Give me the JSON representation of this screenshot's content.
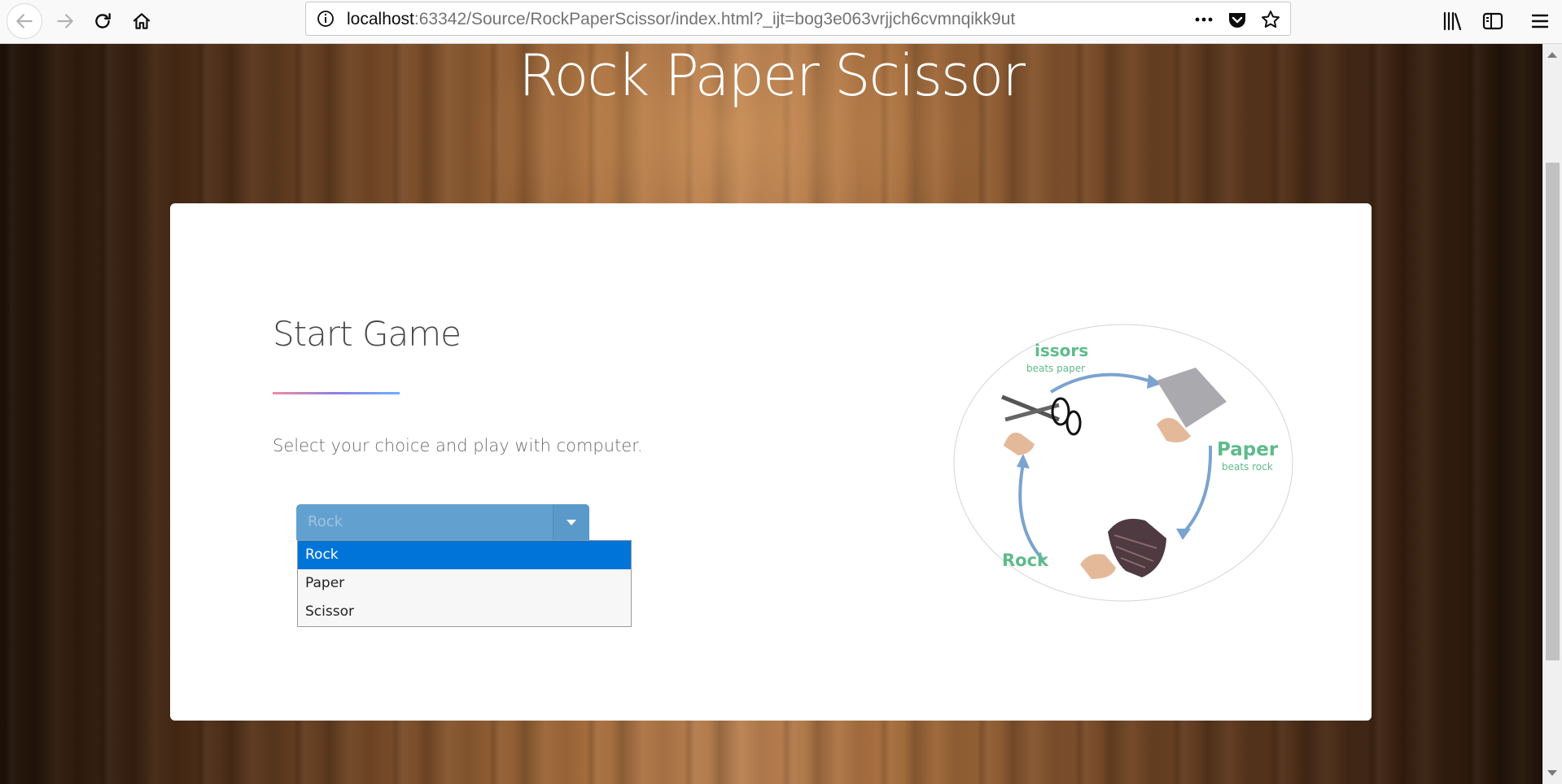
{
  "browser": {
    "url_host": "localhost",
    "url_rest": ":63342/Source/RockPaperScissor/index.html?_ijt=bog3e063vrjjch6cvmnqikk9ut",
    "icons": [
      "back-icon",
      "forward-icon",
      "reload-icon",
      "home-icon",
      "info-icon",
      "more-icon",
      "pocket-icon",
      "star-icon",
      "library-icon",
      "sidebar-icon",
      "menu-icon"
    ]
  },
  "page": {
    "title": "Rock Paper Scissor",
    "game_title": "Start Game",
    "subtitle": "Select your choice and play with computer.",
    "select": {
      "value": "Rock",
      "options": [
        "Rock",
        "Paper",
        "Scissor"
      ],
      "selected_index": 0
    },
    "diagram": {
      "scissors_label": "issors",
      "scissors_caption": "beats paper",
      "paper_label": "Paper",
      "paper_caption": "beats rock",
      "rock_label": "Rock"
    }
  },
  "colors": {
    "select_bg": "#62a1cf",
    "option_highlight": "#0074d9",
    "diagram_green": "#5dbb8a",
    "arrow_blue": "#7ba3cf"
  }
}
